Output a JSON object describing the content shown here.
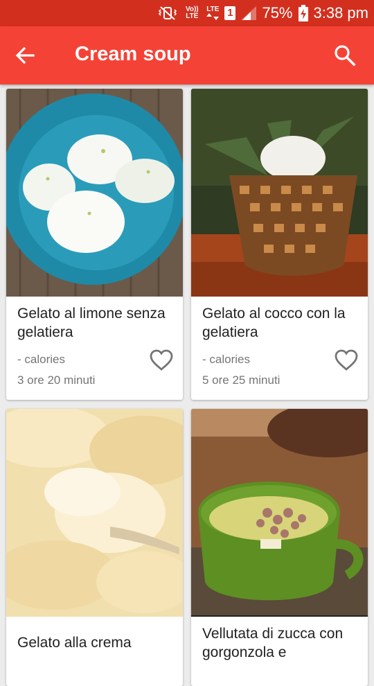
{
  "status_bar": {
    "volte_label": "Vo)) LTE",
    "lte_label": "LTE",
    "sim_slot": "1",
    "battery_percent": "75%",
    "time": "3:38 pm"
  },
  "app_bar": {
    "title": "Cream soup",
    "back_icon": "arrow-left-icon",
    "search_icon": "search-icon"
  },
  "recipes": [
    {
      "title": "Gelato al limone senza gelatiera",
      "calories": "- calories",
      "time": "3 ore 20 minuti",
      "favorite": false
    },
    {
      "title": "Gelato al cocco con la gelatiera",
      "calories": "- calories",
      "time": "5 ore 25 minuti",
      "favorite": false
    },
    {
      "title": "Gelato alla crema"
    },
    {
      "title": "Vellutata di zucca con gorgonzola e"
    }
  ],
  "colors": {
    "status_bar": "#d32f1f",
    "app_bar": "#f44336",
    "background": "#ececec"
  }
}
